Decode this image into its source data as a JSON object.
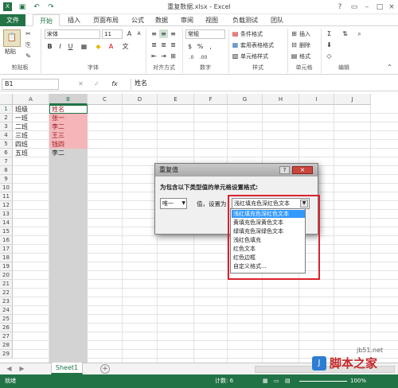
{
  "window": {
    "title": "重复数据.xlsx - Excel"
  },
  "tabs": [
    "文件",
    "开始",
    "插入",
    "页面布局",
    "公式",
    "数据",
    "审阅",
    "视图",
    "负载测试",
    "团队"
  ],
  "ribbon": {
    "paste_label": "粘贴",
    "font_name": "宋体",
    "font_size": "11",
    "number_format": "常规",
    "groups": [
      "剪贴板",
      "字体",
      "对齐方式",
      "数字",
      "样式",
      "单元格",
      "编辑"
    ],
    "style_buttons": [
      "条件格式",
      "套用表格格式",
      "单元格样式"
    ],
    "cell_buttons": [
      "插入",
      "删除",
      "格式"
    ],
    "font_buttons": [
      "B",
      "I",
      "U"
    ]
  },
  "formula_bar": {
    "name_box": "B1",
    "formula": "姓名",
    "fx": "fx"
  },
  "columns": [
    "A",
    "B",
    "C",
    "D",
    "E",
    "F",
    "G",
    "H",
    "I",
    "J"
  ],
  "rows": [
    "1",
    "2",
    "3",
    "4",
    "5",
    "6",
    "7",
    "8",
    "9",
    "10",
    "11",
    "12",
    "13",
    "14",
    "15",
    "16",
    "17",
    "18",
    "19",
    "20",
    "21",
    "22",
    "23",
    "24",
    "25",
    "26",
    "27",
    "28",
    "29"
  ],
  "cells": {
    "col_a": [
      "班级",
      "一班",
      "二班",
      "三班",
      "四班",
      "五班"
    ],
    "col_b": [
      "姓名",
      "张一",
      "李二",
      "王三",
      "钱四",
      "李二"
    ]
  },
  "dialog": {
    "title": "重复值",
    "prompt": "为包含以下类型值的单元格设置格式:",
    "type_value": "唯一",
    "label_value": "值，设置为",
    "selected": "浅红填充色深红色文本",
    "options": [
      "浅红填充色深红色文本",
      "黄填充色深黄色文本",
      "绿填充色深绿色文本",
      "浅红色填充",
      "红色文本",
      "红色边框",
      "自定义格式..."
    ],
    "help": "?",
    "close": "×"
  },
  "sheet": {
    "name": "Sheet1",
    "add": "+"
  },
  "status": {
    "left": "就绪",
    "count": "计数: 6",
    "zoom": "100%"
  },
  "watermark": {
    "site": "jb51.net",
    "brand": "脚本之家"
  },
  "colors": {
    "excel_green": "#217346",
    "highlight_red": "#f4b6b9",
    "text_red": "#9c1c1f"
  }
}
